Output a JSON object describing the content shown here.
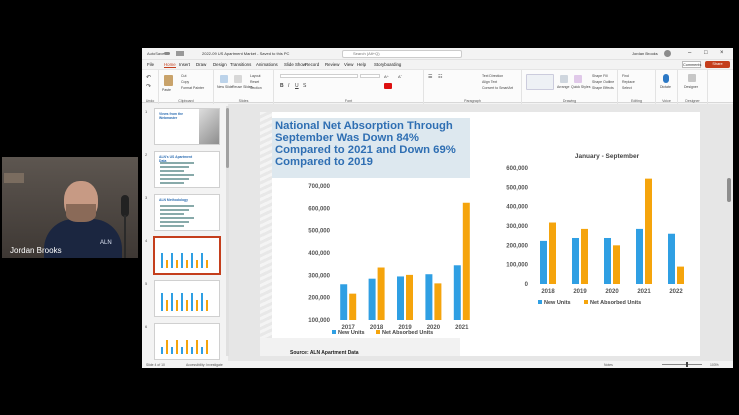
{
  "webcam": {
    "name": "Jordan Brooks",
    "shirt_logo": "ALN"
  },
  "window": {
    "autosave": "AutoSave",
    "doc_name": "2022-09 US Apartment Market - Saved to this PC",
    "search": "Search (Alt+Q)",
    "user": "Jordan Brooks"
  },
  "tabs": [
    "File",
    "Home",
    "Insert",
    "Draw",
    "Design",
    "Transitions",
    "Animations",
    "Slide Show",
    "Record",
    "Review",
    "View",
    "Help",
    "Storyboarding"
  ],
  "active_tab": "Home",
  "buttons": {
    "comments": "Comments",
    "share": "Share"
  },
  "ribbon": {
    "undo": "Undo",
    "clipboard": {
      "paste": "Paste",
      "cut": "Cut",
      "copy": "Copy",
      "format_painter": "Format Painter",
      "label": "Clipboard"
    },
    "slides": {
      "new_slide": "New Slide",
      "reuse": "Reuse Slides",
      "layout": "Layout",
      "reset": "Reset",
      "section": "Section",
      "label": "Slides"
    },
    "font": {
      "label": "Font"
    },
    "paragraph": {
      "text_direction": "Text Direction",
      "align_text": "Align Text",
      "convert": "Convert to SmartArt",
      "label": "Paragraph"
    },
    "drawing": {
      "arrange": "Arrange",
      "quick_styles": "Quick Styles",
      "shape_fill": "Shape Fill",
      "shape_outline": "Shape Outline",
      "shape_effects": "Shape Effects",
      "label": "Drawing"
    },
    "editing": {
      "find": "Find",
      "replace": "Replace",
      "select": "Select",
      "label": "Editing"
    },
    "voice": {
      "dictate": "Dictate",
      "label": "Voice"
    },
    "designer": {
      "designer": "Designer",
      "label": "Designer"
    }
  },
  "slide": {
    "title": "National Net Absorption Through September Was Down 84% Compared to 2021 and Down 69% Compared to 2019",
    "source": "Source: ALN Apartment Data"
  },
  "chart_data": [
    {
      "type": "bar",
      "title": "",
      "categories": [
        "2017",
        "2018",
        "2019",
        "2020",
        "2021"
      ],
      "series": [
        {
          "name": "New Units",
          "values": [
            260000,
            285000,
            295000,
            305000,
            345000
          ]
        },
        {
          "name": "Net Absorbed Units",
          "values": [
            218000,
            335000,
            302000,
            264000,
            625000
          ]
        }
      ],
      "ylim": [
        100000,
        700000
      ],
      "yticks": [
        "700,000",
        "600,000",
        "500,000",
        "400,000",
        "300,000",
        "200,000",
        "100,000"
      ],
      "legend": "bottom",
      "colors": [
        "#2f9fe3",
        "#f5a40c"
      ]
    },
    {
      "type": "bar",
      "title": "January - September",
      "categories": [
        "2018",
        "2019",
        "2020",
        "2021",
        "2022"
      ],
      "series": [
        {
          "name": "New Units",
          "values": [
            223000,
            238000,
            238000,
            285000,
            260000
          ]
        },
        {
          "name": "Net Absorbed Units",
          "values": [
            318000,
            285000,
            200000,
            545000,
            90000
          ]
        }
      ],
      "ylim": [
        0,
        600000
      ],
      "yticks": [
        "600,000",
        "500,000",
        "400,000",
        "300,000",
        "200,000",
        "100,000",
        "0"
      ],
      "legend": "bottom",
      "colors": [
        "#2f9fe3",
        "#f5a40c"
      ]
    }
  ],
  "thumbnails": [
    {
      "num": "1",
      "title": "Views from the Webmaster"
    },
    {
      "num": "2",
      "title": "ALN's US Apartment Data"
    },
    {
      "num": "3",
      "title": "ALN Methodology"
    },
    {
      "num": "4",
      "title": ""
    },
    {
      "num": "5",
      "title": ""
    },
    {
      "num": "6",
      "title": ""
    }
  ],
  "status": {
    "slide_of": "Slide 4 of 10",
    "accessibility": "Accessibility: Investigate",
    "notes": "Notes",
    "zoom": "103%"
  }
}
